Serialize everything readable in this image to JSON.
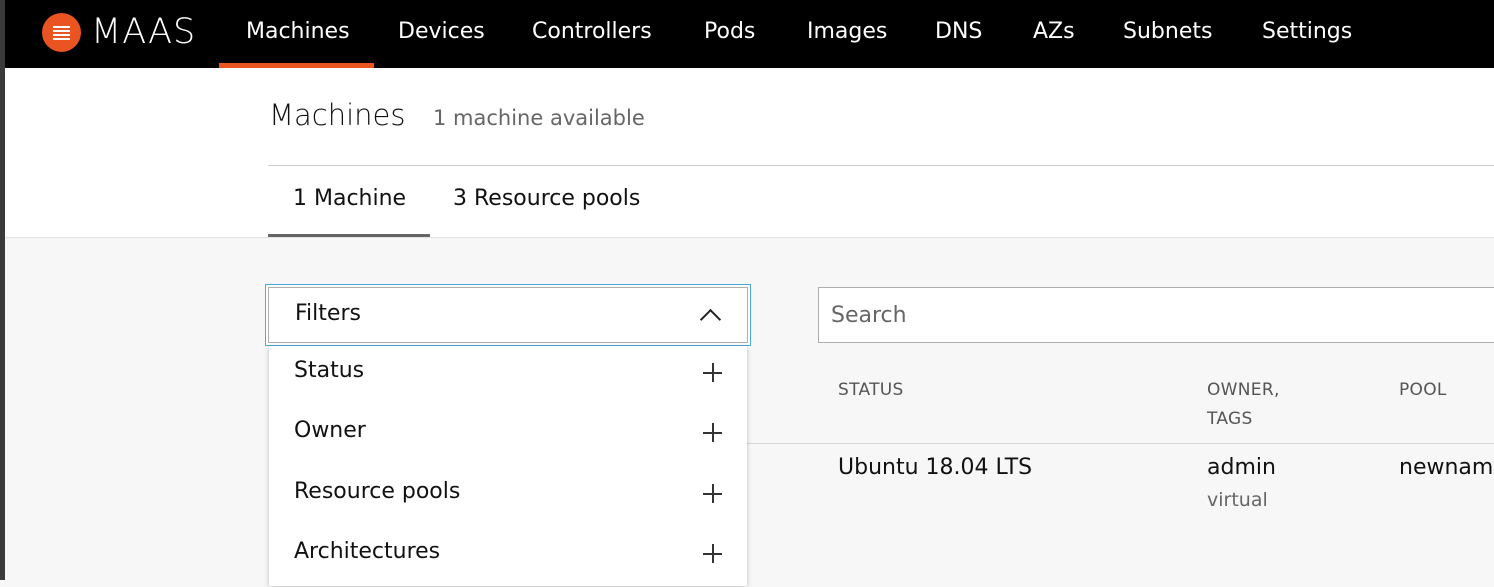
{
  "nav": {
    "brand": "MAAS",
    "items": [
      {
        "label": "Machines",
        "active": true
      },
      {
        "label": "Devices"
      },
      {
        "label": "Controllers"
      },
      {
        "label": "Pods"
      },
      {
        "label": "Images"
      },
      {
        "label": "DNS"
      },
      {
        "label": "AZs"
      },
      {
        "label": "Subnets"
      },
      {
        "label": "Settings"
      }
    ],
    "accent_color": "#e95420"
  },
  "header": {
    "title": "Machines",
    "subtitle": "1 machine available",
    "tabs": [
      {
        "label": "1 Machine",
        "active": true
      },
      {
        "label": "3 Resource pools"
      }
    ]
  },
  "filters": {
    "label": "Filters",
    "toggle_icon": "chevron-up-icon",
    "items": [
      {
        "label": "Status",
        "icon": "plus-icon"
      },
      {
        "label": "Owner",
        "icon": "plus-icon"
      },
      {
        "label": "Resource pools",
        "icon": "plus-icon"
      },
      {
        "label": "Architectures",
        "icon": "plus-icon"
      }
    ]
  },
  "search": {
    "placeholder": "Search",
    "value": ""
  },
  "table": {
    "headers": {
      "status": "STATUS",
      "owner_line1": "OWNER,",
      "owner_line2": "TAGS",
      "pool": "POOL"
    },
    "rows": [
      {
        "status": "Ubuntu 18.04 LTS",
        "owner": "admin",
        "tags": "virtual",
        "pool": "newname"
      }
    ]
  }
}
